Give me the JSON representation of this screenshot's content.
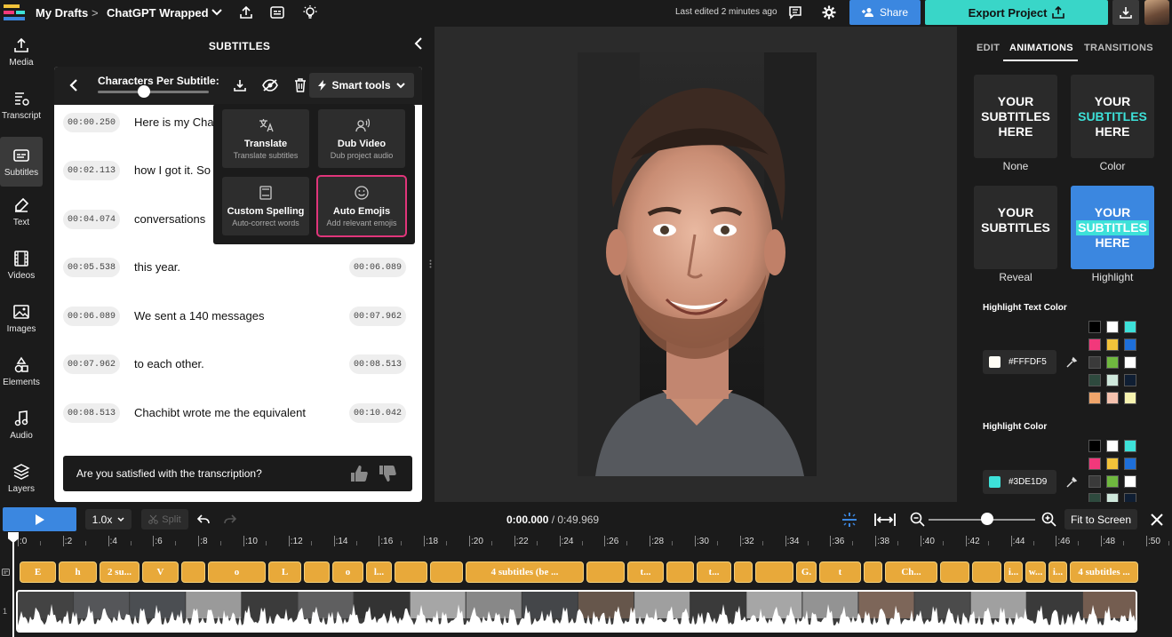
{
  "topbar": {
    "breadcrumb_root": "My Drafts",
    "breadcrumb_sep": ">",
    "project_name": "ChatGPT Wrapped",
    "last_edited": "Last edited 2 minutes ago",
    "share_label": "Share",
    "export_label": "Export Project"
  },
  "leftnav": [
    {
      "label": "Media",
      "icon": "upload-icon"
    },
    {
      "label": "Transcript",
      "icon": "transcript-icon"
    },
    {
      "label": "Subtitles",
      "icon": "subtitles-icon",
      "active": true
    },
    {
      "label": "Text",
      "icon": "text-icon"
    },
    {
      "label": "Videos",
      "icon": "film-icon"
    },
    {
      "label": "Images",
      "icon": "image-icon"
    },
    {
      "label": "Elements",
      "icon": "shapes-icon"
    },
    {
      "label": "Audio",
      "icon": "music-note-icon"
    },
    {
      "label": "Layers",
      "icon": "layers-icon"
    }
  ],
  "subtitles": {
    "panel_title": "SUBTITLES",
    "cps_label": "Characters Per Subtitle:",
    "smart_tools_label": "Smart tools",
    "rows": [
      {
        "start": "00:00.250",
        "text": "Here is my Cha",
        "end": ""
      },
      {
        "start": "00:02.113",
        "text": "how I got it. So",
        "end": ""
      },
      {
        "start": "00:04.074",
        "text": "conversations",
        "end": ""
      },
      {
        "start": "00:05.538",
        "text": "this year.",
        "end": "00:06.089"
      },
      {
        "start": "00:06.089",
        "text": "We sent a 140 messages",
        "end": "00:07.962"
      },
      {
        "start": "00:07.962",
        "text": "to each other.",
        "end": "00:08.513"
      },
      {
        "start": "00:08.513",
        "text": "Chachibt wrote me the equivalent",
        "end": "00:10.042"
      }
    ],
    "feedback_question": "Are you satisfied with the transcription?"
  },
  "smart_tools": [
    {
      "name": "Translate",
      "desc": "Translate subtitles",
      "icon": "translate-icon"
    },
    {
      "name": "Dub Video",
      "desc": "Dub project audio",
      "icon": "dub-voice-icon"
    },
    {
      "name": "Custom Spelling",
      "desc": "Auto-correct words",
      "icon": "book-icon"
    },
    {
      "name": "Auto Emojis",
      "desc": "Add relevant emojis",
      "icon": "smiley-icon",
      "selected": true
    }
  ],
  "right_panel": {
    "tabs": [
      "EDIT",
      "ANIMATIONS",
      "TRANSITIONS"
    ],
    "active_tab": "ANIMATIONS",
    "animations": [
      {
        "label": "None",
        "preview": [
          "YOUR",
          "SUBTITLES",
          "HERE"
        ]
      },
      {
        "label": "Color",
        "preview": [
          "YOUR",
          "SUBTITLES",
          "HERE"
        ]
      },
      {
        "label": "Reveal",
        "preview": [
          "YOUR",
          "SUBTITLES",
          ""
        ]
      },
      {
        "label": "Highlight",
        "preview": [
          "YOUR",
          "SUBTITLES",
          "HERE"
        ]
      }
    ],
    "highlight_text_color_label": "Highlight Text Color",
    "highlight_text_color_value": "#FFFDF5",
    "highlight_color_label": "Highlight Color",
    "highlight_color_value": "#3DE1D9",
    "palette": [
      "#000000",
      "#ffffff",
      "#3de1d9",
      "#f2387b",
      "#f2c33a",
      "#1e6fd9",
      "#3a3a3a",
      "#6fb83f",
      "#ffffff",
      "#2e4a3e",
      "#cfe8dc",
      "#0f1e33",
      "#f0a56b",
      "#f5c2ae",
      "#f7f3b0"
    ]
  },
  "timeline": {
    "speed": "1.0x",
    "split_label": "Split",
    "current_time": "0:00.000",
    "total_time": " / 0:49.969",
    "fit_label": "Fit to Screen",
    "ticks": [
      ":0",
      ":2",
      ":4",
      ":6",
      ":8",
      ":10",
      ":12",
      ":14",
      ":16",
      ":18",
      ":20",
      ":22",
      ":24",
      ":26",
      ":28",
      ":30",
      ":32",
      ":34",
      ":36",
      ":38",
      ":40",
      ":42",
      ":44",
      ":46",
      ":48",
      ":50"
    ],
    "clips": [
      "E",
      "h",
      "2 su...",
      "V",
      "",
      "o",
      "L",
      "",
      "o",
      "l...",
      "",
      "",
      "4 subtitles (be ...",
      "",
      "t...",
      "",
      "t...",
      "",
      "",
      "G.",
      "t",
      "",
      "Ch...",
      "",
      "",
      "i...",
      "w...",
      "i...",
      "4 subtitles ..."
    ],
    "track_nums": [
      "",
      "1"
    ]
  },
  "colors": {
    "accent_blue": "#3b87e0",
    "accent_teal": "#39d6c8",
    "clip_orange": "#e8a93a",
    "selected_outline": "#e0357a"
  }
}
